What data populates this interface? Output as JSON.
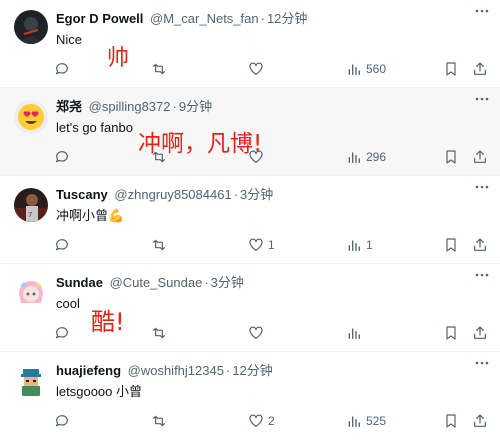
{
  "tweets": [
    {
      "name": "Egor D Powell",
      "handle": "@M_car_Nets_fan",
      "time": "12分钟",
      "text": "Nice",
      "overlay": "帅",
      "replies": "",
      "retweets": "",
      "likes": "",
      "views": "560"
    },
    {
      "name": "郑尧",
      "handle": "@spilling8372",
      "time": "9分钟",
      "text": "let's go fanbo",
      "overlay": "冲啊，凡博!",
      "replies": "",
      "retweets": "",
      "likes": "",
      "views": "296"
    },
    {
      "name": "Tuscany",
      "handle": "@zhngruy85084461",
      "time": "3分钟",
      "text": "冲啊小曾💪",
      "overlay": "",
      "replies": "",
      "retweets": "",
      "likes": "1",
      "views": "1"
    },
    {
      "name": "Sundae",
      "handle": "@Cute_Sundae",
      "time": "3分钟",
      "text": "cool",
      "overlay": "酷!",
      "replies": "",
      "retweets": "",
      "likes": "",
      "views": ""
    },
    {
      "name": "huajiefeng",
      "handle": "@woshifhj12345",
      "time": "12分钟",
      "text": "letsgoooo 小曾",
      "overlay": "",
      "replies": "",
      "retweets": "",
      "likes": "2",
      "views": "525"
    }
  ],
  "icons": {
    "reply": "reply-icon",
    "retweet": "retweet-icon",
    "like": "heart-icon",
    "views": "views-chart-icon",
    "bookmark": "bookmark-icon",
    "share": "share-icon",
    "more": "more-options-icon"
  },
  "colors": {
    "overlay_text": "#e2231a",
    "secondary_text": "#536471",
    "highlight_bg": "#f7f7f7"
  }
}
